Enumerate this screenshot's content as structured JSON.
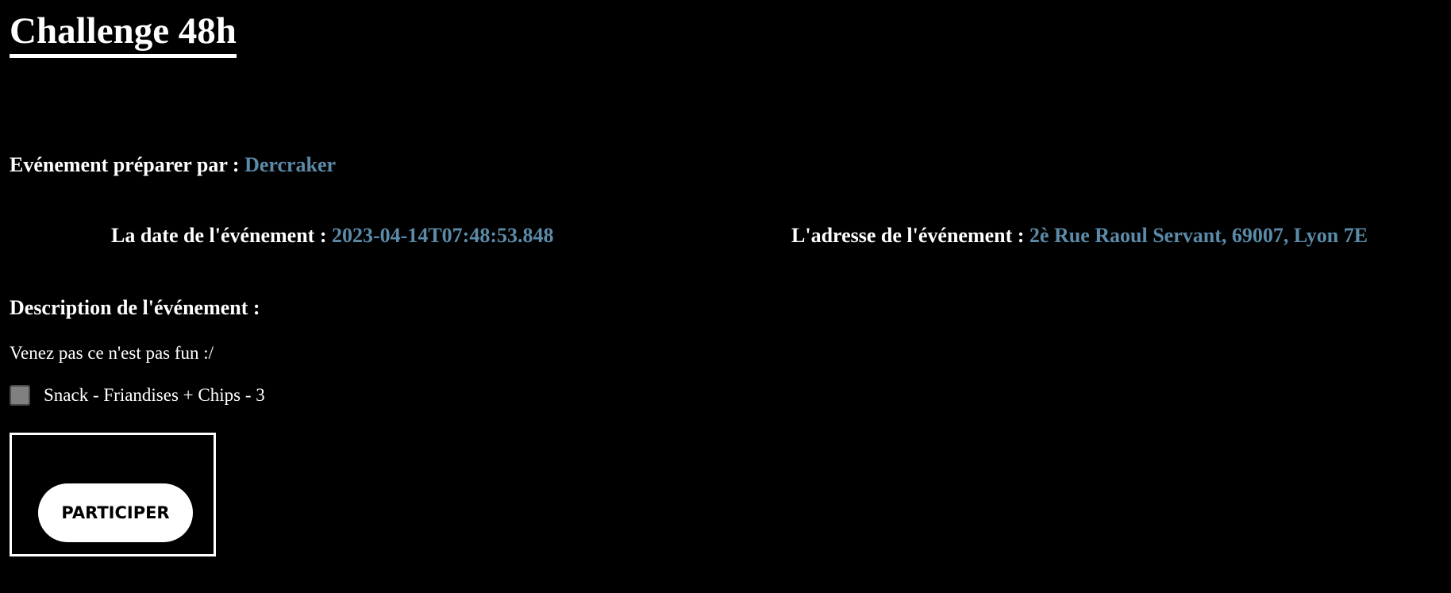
{
  "page": {
    "title": "Challenge 48h"
  },
  "organizer": {
    "label": "Evénement préparer par : ",
    "name": "Dercraker"
  },
  "event_date": {
    "label": "La date de l'événement : ",
    "value": "2023-04-14T07:48:53.848"
  },
  "event_address": {
    "label": "L'adresse de l'événement : ",
    "value": "2è Rue Raoul Servant, 69007, Lyon 7E"
  },
  "description": {
    "heading": "Description de l'événement :",
    "text": "Venez pas ce n'est pas fun :/"
  },
  "snack": {
    "label": "Snack - Friandises + Chips - 3",
    "checked": false
  },
  "actions": {
    "participate_label": "PARTICIPER"
  },
  "colors": {
    "background": "#000000",
    "text": "#ffffff",
    "accent": "#5b8ba9"
  }
}
